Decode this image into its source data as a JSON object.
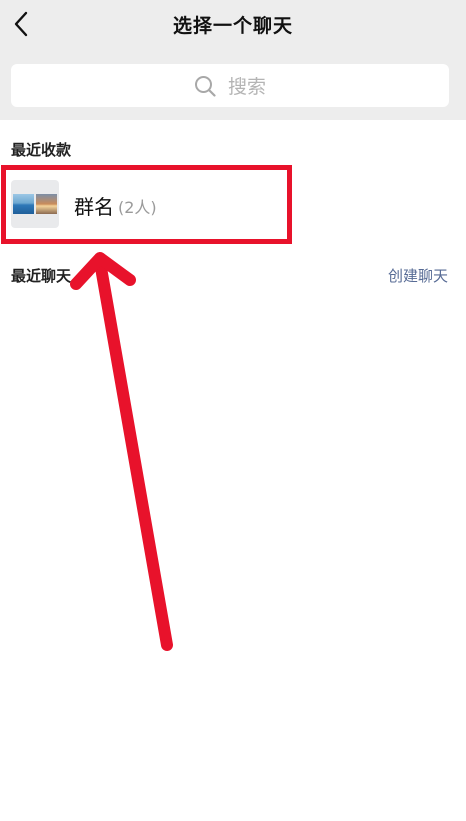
{
  "header": {
    "title": "选择一个聊天",
    "back_icon": "chevron-left-icon"
  },
  "search": {
    "placeholder": "搜索",
    "icon": "search-icon"
  },
  "recent_payments": {
    "label": "最近收款",
    "items": [
      {
        "name": "群名",
        "member_count": "(2人)"
      }
    ]
  },
  "recent_chats": {
    "label": "最近聊天",
    "create_label": "创建聊天"
  },
  "colors": {
    "header_bg": "#ededed",
    "highlight": "#e8122b",
    "link": "#576b95"
  }
}
